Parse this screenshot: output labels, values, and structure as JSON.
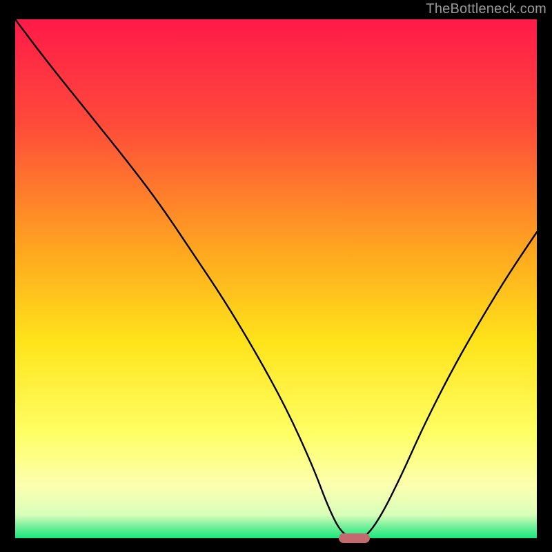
{
  "branding": {
    "attribution": "TheBottleneck.com"
  },
  "chart_data": {
    "type": "line",
    "title": "",
    "xlabel": "",
    "ylabel": "",
    "xlim": [
      0,
      100
    ],
    "ylim": [
      0,
      100
    ],
    "grid": false,
    "legend": false,
    "background_gradient_stops": [
      {
        "offset": 0.0,
        "color": "#ff1a49"
      },
      {
        "offset": 0.2,
        "color": "#ff4a3a"
      },
      {
        "offset": 0.45,
        "color": "#ffa81f"
      },
      {
        "offset": 0.62,
        "color": "#ffe31a"
      },
      {
        "offset": 0.8,
        "color": "#ffff66"
      },
      {
        "offset": 0.9,
        "color": "#fbffb0"
      },
      {
        "offset": 0.955,
        "color": "#d8ffb8"
      },
      {
        "offset": 0.975,
        "color": "#7ff0a0"
      },
      {
        "offset": 1.0,
        "color": "#18e87a"
      }
    ],
    "series": [
      {
        "name": "bottleneck-curve",
        "color": "#000000",
        "x": [
          0,
          6,
          14,
          22,
          28,
          34,
          40,
          46,
          52,
          57,
          60,
          62.5,
          65,
          67,
          70,
          74,
          78,
          83,
          88,
          94,
          100
        ],
        "y": [
          100,
          92,
          82,
          72,
          64,
          55,
          46,
          36,
          25,
          14,
          6,
          1,
          0,
          0,
          4,
          12,
          21,
          31,
          40,
          50,
          59
        ]
      }
    ],
    "optimal_marker": {
      "x_start": 62,
      "x_end": 68,
      "y": 0,
      "color": "#c46a6e"
    }
  }
}
